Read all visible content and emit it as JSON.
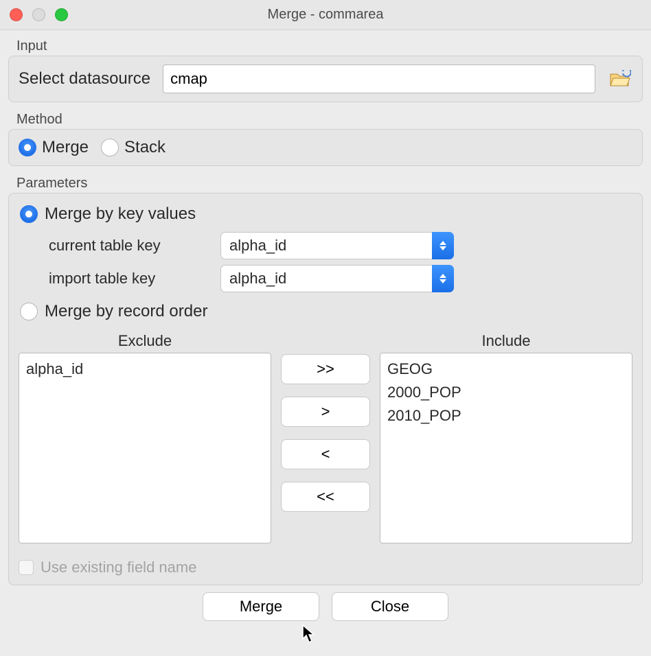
{
  "window": {
    "title": "Merge - commarea"
  },
  "input": {
    "group_label": "Input",
    "label": "Select datasource",
    "value": "cmap"
  },
  "method": {
    "group_label": "Method",
    "options": {
      "merge": "Merge",
      "stack": "Stack"
    },
    "selected": "merge"
  },
  "parameters": {
    "group_label": "Parameters",
    "merge_by_key": {
      "label": "Merge by key values",
      "selected": true,
      "current_key_label": "current table key",
      "current_key_value": "alpha_id",
      "import_key_label": "import table key",
      "import_key_value": "alpha_id"
    },
    "merge_by_order": {
      "label": "Merge by record order",
      "selected": false
    },
    "exclude_header": "Exclude",
    "include_header": "Include",
    "exclude_items": [
      "alpha_id"
    ],
    "include_items": [
      "GEOG",
      "2000_POP",
      "2010_POP"
    ],
    "move_buttons": {
      "all_right": ">>",
      "right": ">",
      "left": "<",
      "all_left": "<<"
    },
    "use_existing": {
      "label": "Use existing field name",
      "checked": false,
      "enabled": false
    }
  },
  "buttons": {
    "merge": "Merge",
    "close": "Close"
  }
}
